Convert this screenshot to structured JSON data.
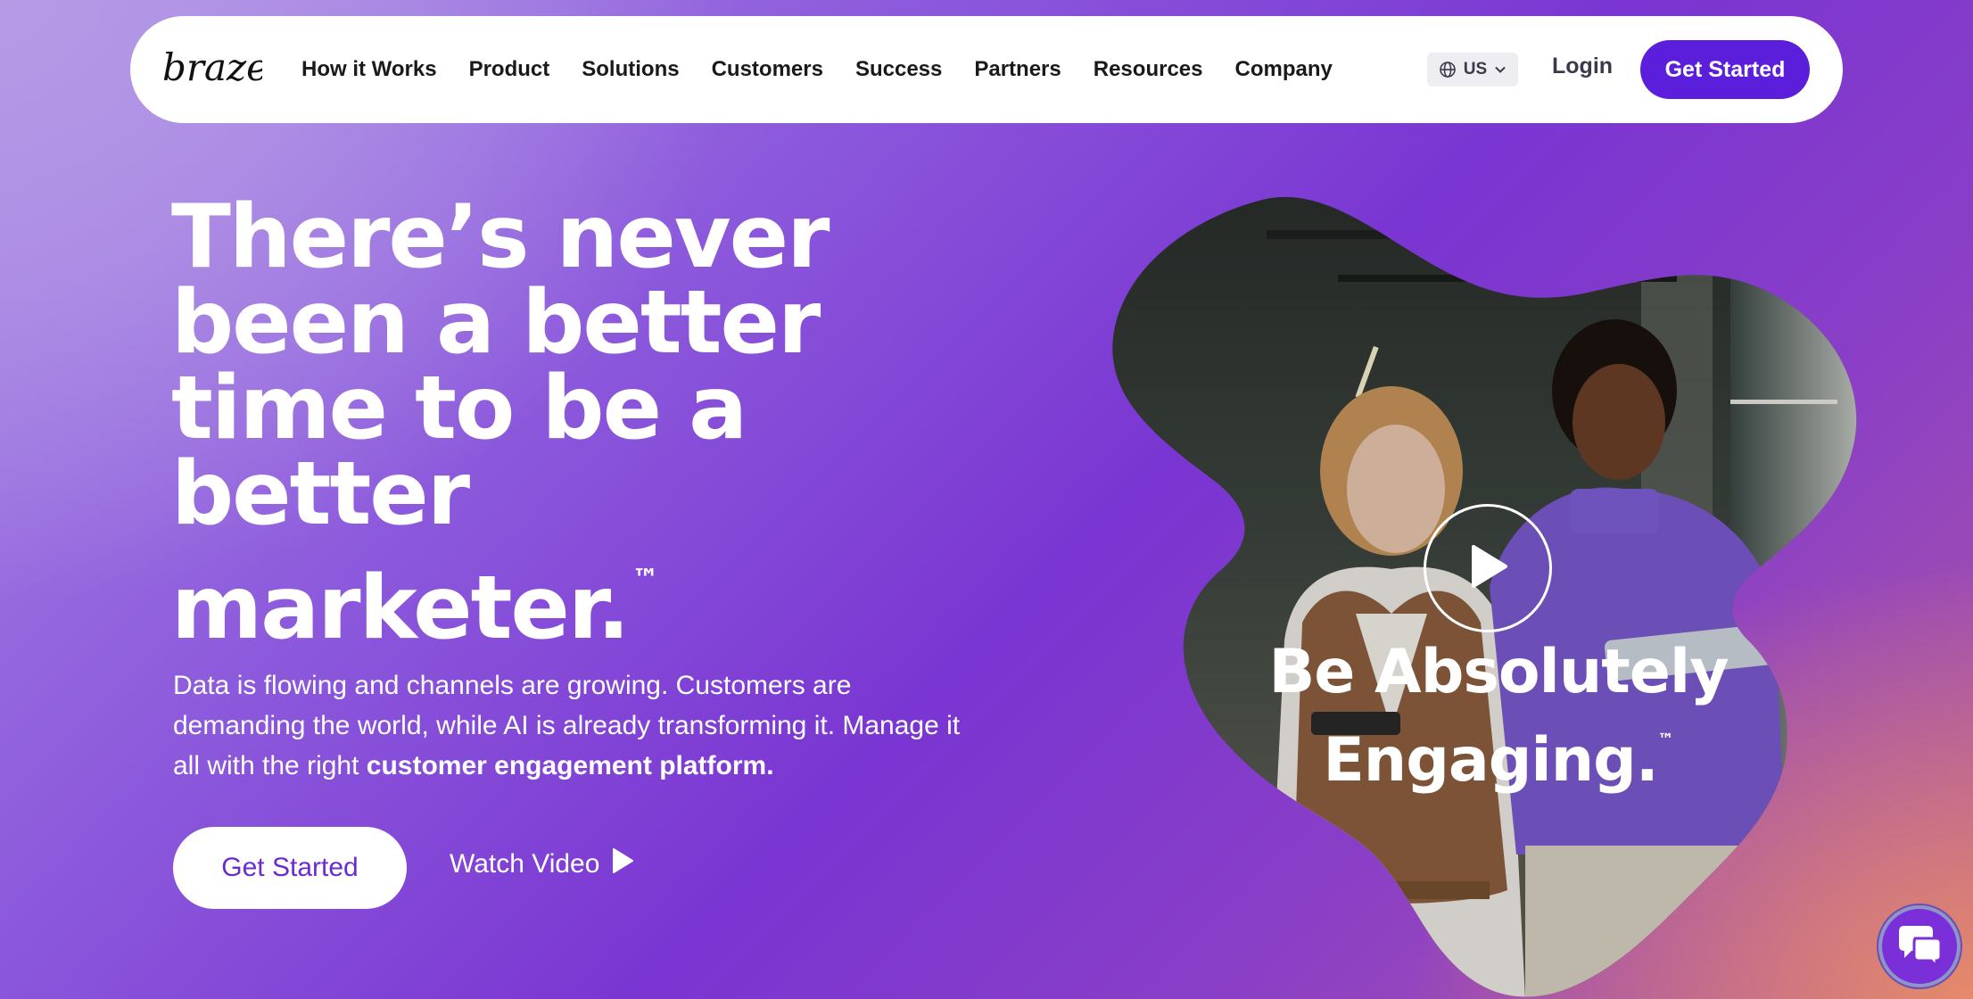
{
  "nav": {
    "logo_text": "braze",
    "links": [
      "How it Works",
      "Product",
      "Solutions",
      "Customers",
      "Success",
      "Partners",
      "Resources",
      "Company"
    ],
    "locale_label": "US",
    "login_label": "Login",
    "cta_label": "Get Started"
  },
  "hero": {
    "headline_lines": [
      "There’s never",
      "been a better",
      "time to be a",
      "better",
      "marketer."
    ],
    "headline_tm": "™",
    "sub_text": "Data is flowing and channels are growing. Customers are demanding the world, while AI is already transforming it. Manage it all with the right ",
    "sub_bold": "customer engagement platform.",
    "cta_label": "Get Started",
    "watch_label": "Watch Video"
  },
  "video": {
    "title_line1": "Be Absolutely",
    "title_line2": "Engaging.",
    "title_tm": "™"
  },
  "colors": {
    "brand_purple": "#5b1fdc",
    "cta_text_purple": "#6a2bd0",
    "chat_purple": "#7b2fd8"
  },
  "icons": {
    "locale": "globe-icon",
    "locale_caret": "chevron-down-icon",
    "watch": "play-triangle-icon",
    "video_play": "play-circle-icon",
    "chat": "chat-bubbles-icon"
  }
}
